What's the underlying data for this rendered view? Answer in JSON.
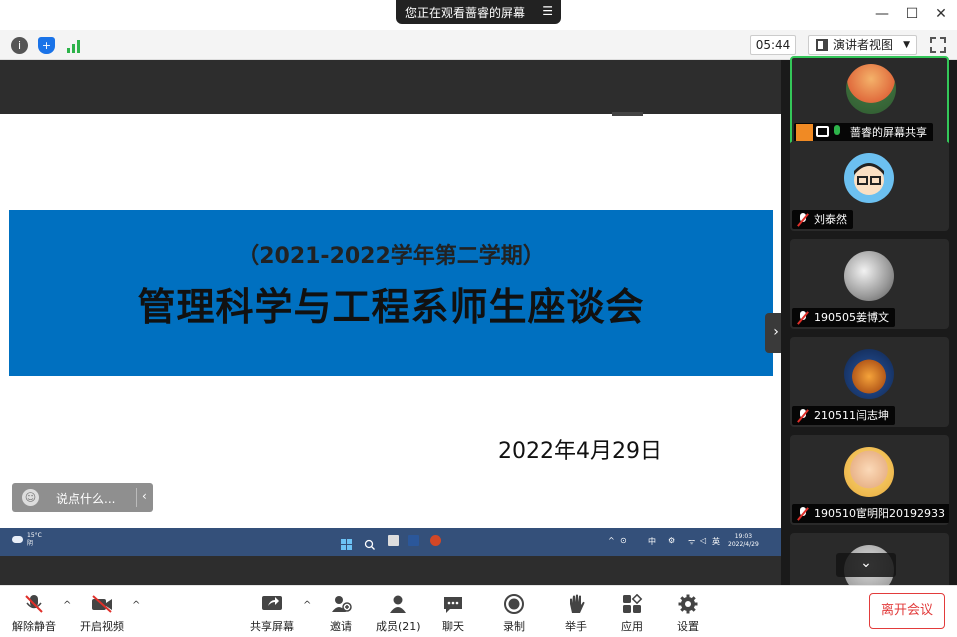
{
  "share_banner": {
    "text": "您正在观看蔷睿的屏幕",
    "menu_icon": "menu-icon"
  },
  "window_controls": {
    "minimize": "—",
    "maximize": "☐",
    "close": "✕"
  },
  "meeting_toolbar": {
    "info_icon": "i",
    "security_icon": "+",
    "timer": "05:44",
    "view_mode": "演讲者视图",
    "view_dropdown": "▼"
  },
  "slide": {
    "subtitle": "（2021-2022学年第二学期）",
    "title": "管理科学与工程系师生座谈会",
    "date": "2022年4月29日",
    "banner_color": "#0070c0"
  },
  "chat_input": {
    "placeholder": "说点什么...",
    "collapse": "‹",
    "emoji": "☺"
  },
  "taskbar": {
    "weather_temp": "15°C",
    "weather_desc": "阴",
    "time": "19:03",
    "date": "2022/4/29",
    "tray_icons": [
      "^",
      "⊙",
      "中",
      "⚙",
      "ᯤ",
      "◁",
      "英"
    ]
  },
  "participants": [
    {
      "name": "蔷睿的屏幕共享",
      "muted": false,
      "active": true
    },
    {
      "name": "刘泰然",
      "muted": true
    },
    {
      "name": "190505姜博文",
      "muted": true
    },
    {
      "name": "210511闫志坤",
      "muted": true
    },
    {
      "name": "190510宦明阳20192933",
      "muted": true
    }
  ],
  "panel_scroll": "⌄",
  "side_toggle": "›",
  "bottom_bar": {
    "unmute": "解除静音",
    "start_video": "开启视频",
    "share_screen": "共享屏幕",
    "invite": "邀请",
    "members": "成员(21)",
    "chat": "聊天",
    "record": "录制",
    "raise_hand": "举手",
    "apps": "应用",
    "settings": "设置",
    "leave": "离开会议",
    "caret": "^"
  }
}
